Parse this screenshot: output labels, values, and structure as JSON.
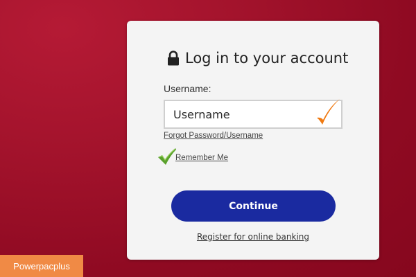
{
  "login": {
    "title": "Log in to your account",
    "lock_icon": "lock-icon",
    "username_label": "Username:",
    "username_value": "Username",
    "input_check_icon": "orange-checkmark-icon",
    "forgot_link": "Forgot Password/Username",
    "remember_icon": "green-checkmark-icon",
    "remember_label": "Remember Me",
    "continue_label": "Continue",
    "register_link": "Register for online banking"
  },
  "watermark": {
    "label": "Powerpacplus"
  },
  "colors": {
    "background": "#9e1029",
    "card": "#f4f4f4",
    "button": "#1a2aa0",
    "badge": "#f08a45",
    "orange_check": "#f07a12",
    "green_check": "#5aa12c"
  }
}
